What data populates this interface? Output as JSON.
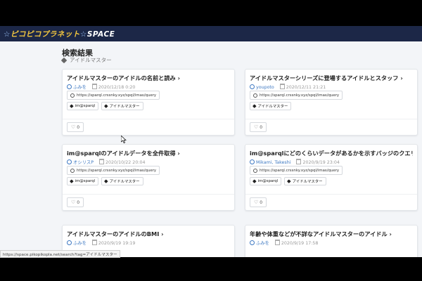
{
  "brand": {
    "part1": "ピコピコプラネット",
    "star": "☆",
    "part2": "SPACE"
  },
  "page": {
    "title": "検索結果",
    "tag_filter": "アイドルマスター"
  },
  "cards": [
    {
      "title": "アイドルマスターのアイドルの名前と読み ›",
      "author": "ふみを",
      "date": "2020/12/18 0:20",
      "endpoint": "https://sparql.crssnky.xyz/spql/imas/query",
      "tags": [
        "im@sparql",
        "アイドルマスター"
      ],
      "likes": "0"
    },
    {
      "title": "アイドルマスターシリーズに登場するアイドルとスタッフ ›",
      "author": "youpoto",
      "date": "2020/12/11 21:21",
      "endpoint": "https://sparql.crssnky.xyz/spql/imas/query",
      "tags": [
        "アイドルマスター"
      ],
      "likes": "0"
    },
    {
      "title": "im@sparqlのアイドルデータを全件取得 ›",
      "author": "オシリスP",
      "date": "2020/10/22 20:04",
      "endpoint": "https://sparql.crssnky.xyz/spql/imas/query",
      "tags": [
        "im@sparql",
        "アイドルマスター"
      ],
      "likes": "0"
    },
    {
      "title": "im@sparqlにどのくらいデータがあるかを示すバッジのクエリ ›",
      "author": "Mikami, Takeshi",
      "date": "2020/9/19 23:04",
      "endpoint": "https://sparql.crssnky.xyz/spql/imas/query",
      "tags": [
        "im@sparql",
        "アイドルマスター"
      ],
      "likes": "0"
    },
    {
      "title": "アイドルマスターのアイドルのBMI ›",
      "author": "ふみを",
      "date": "2020/9/19 19:19",
      "endpoint": "",
      "tags": [],
      "likes": ""
    },
    {
      "title": "年齢や体重などが不詳なアイドルマスターのアイドル ›",
      "author": "ふみを",
      "date": "2020/9/19 17:58",
      "endpoint": "",
      "tags": [],
      "likes": ""
    }
  ],
  "status_bar": {
    "url": "https://space.pikopikopla.net/search?tag=アイドルマスター"
  }
}
